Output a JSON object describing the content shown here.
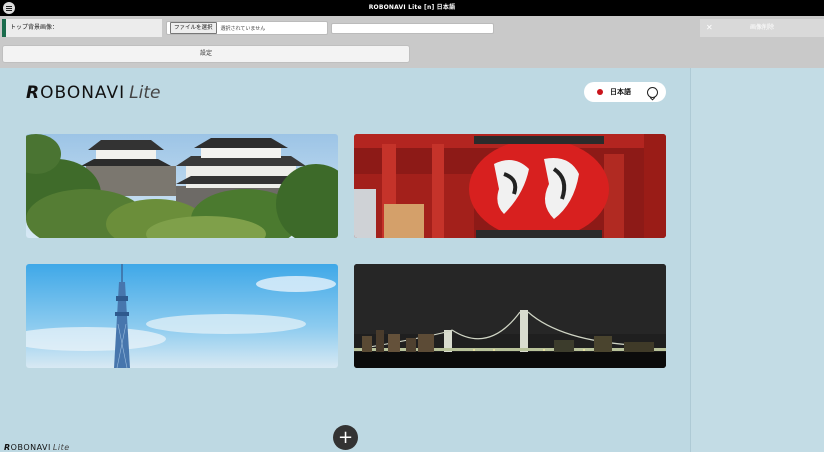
{
  "window": {
    "title": "ROBONAVI Lite [n] 日本語"
  },
  "settings": {
    "top_image_label": "トップ背景画像：",
    "file_button": "ファイルを選択",
    "file_status": "選択されていません",
    "save_label": "設定",
    "delete_label": "画像削除"
  },
  "brand": {
    "logo_main": "OBONAVI",
    "logo_initial": "R",
    "logo_suffix": "Lite"
  },
  "language": {
    "selected": "日本語"
  },
  "cards": [
    {
      "subject": "castle"
    },
    {
      "subject": "lantern"
    },
    {
      "subject": "tower"
    },
    {
      "subject": "bridge-night"
    }
  ],
  "footer": {
    "logo_initial": "R",
    "logo_main": "OBONAVI",
    "logo_suffix": "Lite"
  },
  "colors": {
    "main_bg": "#bed9e3",
    "accent": "#1a6b4c",
    "flag_red": "#c9141b"
  }
}
